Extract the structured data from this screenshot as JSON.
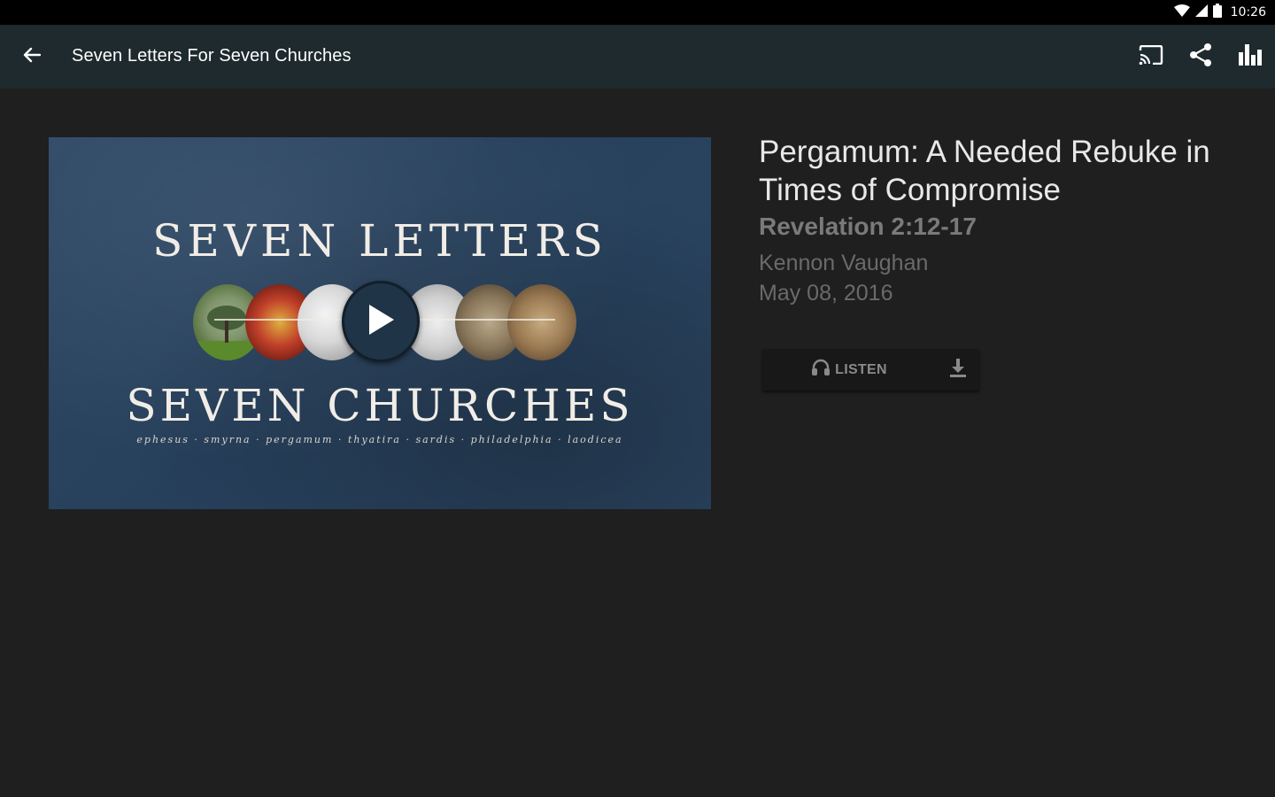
{
  "status_bar": {
    "time": "10:26"
  },
  "app_bar": {
    "title": "Seven Letters For Seven Churches"
  },
  "hero": {
    "title_top": "SEVEN LETTERS",
    "title_bottom": "SEVEN CHURCHES",
    "cities": "ephesus · smyrna · pergamum · thyatira · sardis · philadelphia · laodicea"
  },
  "sermon": {
    "title": "Pergamum: A Needed Rebuke in Times of Compromise",
    "scripture": "Revelation 2:12-17",
    "speaker": "Kennon Vaughan",
    "date": "May 08, 2016"
  },
  "actions": {
    "listen_label": "LISTEN"
  },
  "colors": {
    "app_bar": "#1e2a2d",
    "background": "#1f1f1f",
    "hero_blue": "#2e4966"
  },
  "icons": [
    "arrow-back-icon",
    "cast-icon",
    "share-icon",
    "bar-chart-icon",
    "play-icon",
    "headphones-icon",
    "download-icon",
    "wifi-icon",
    "signal-icon",
    "battery-icon"
  ]
}
